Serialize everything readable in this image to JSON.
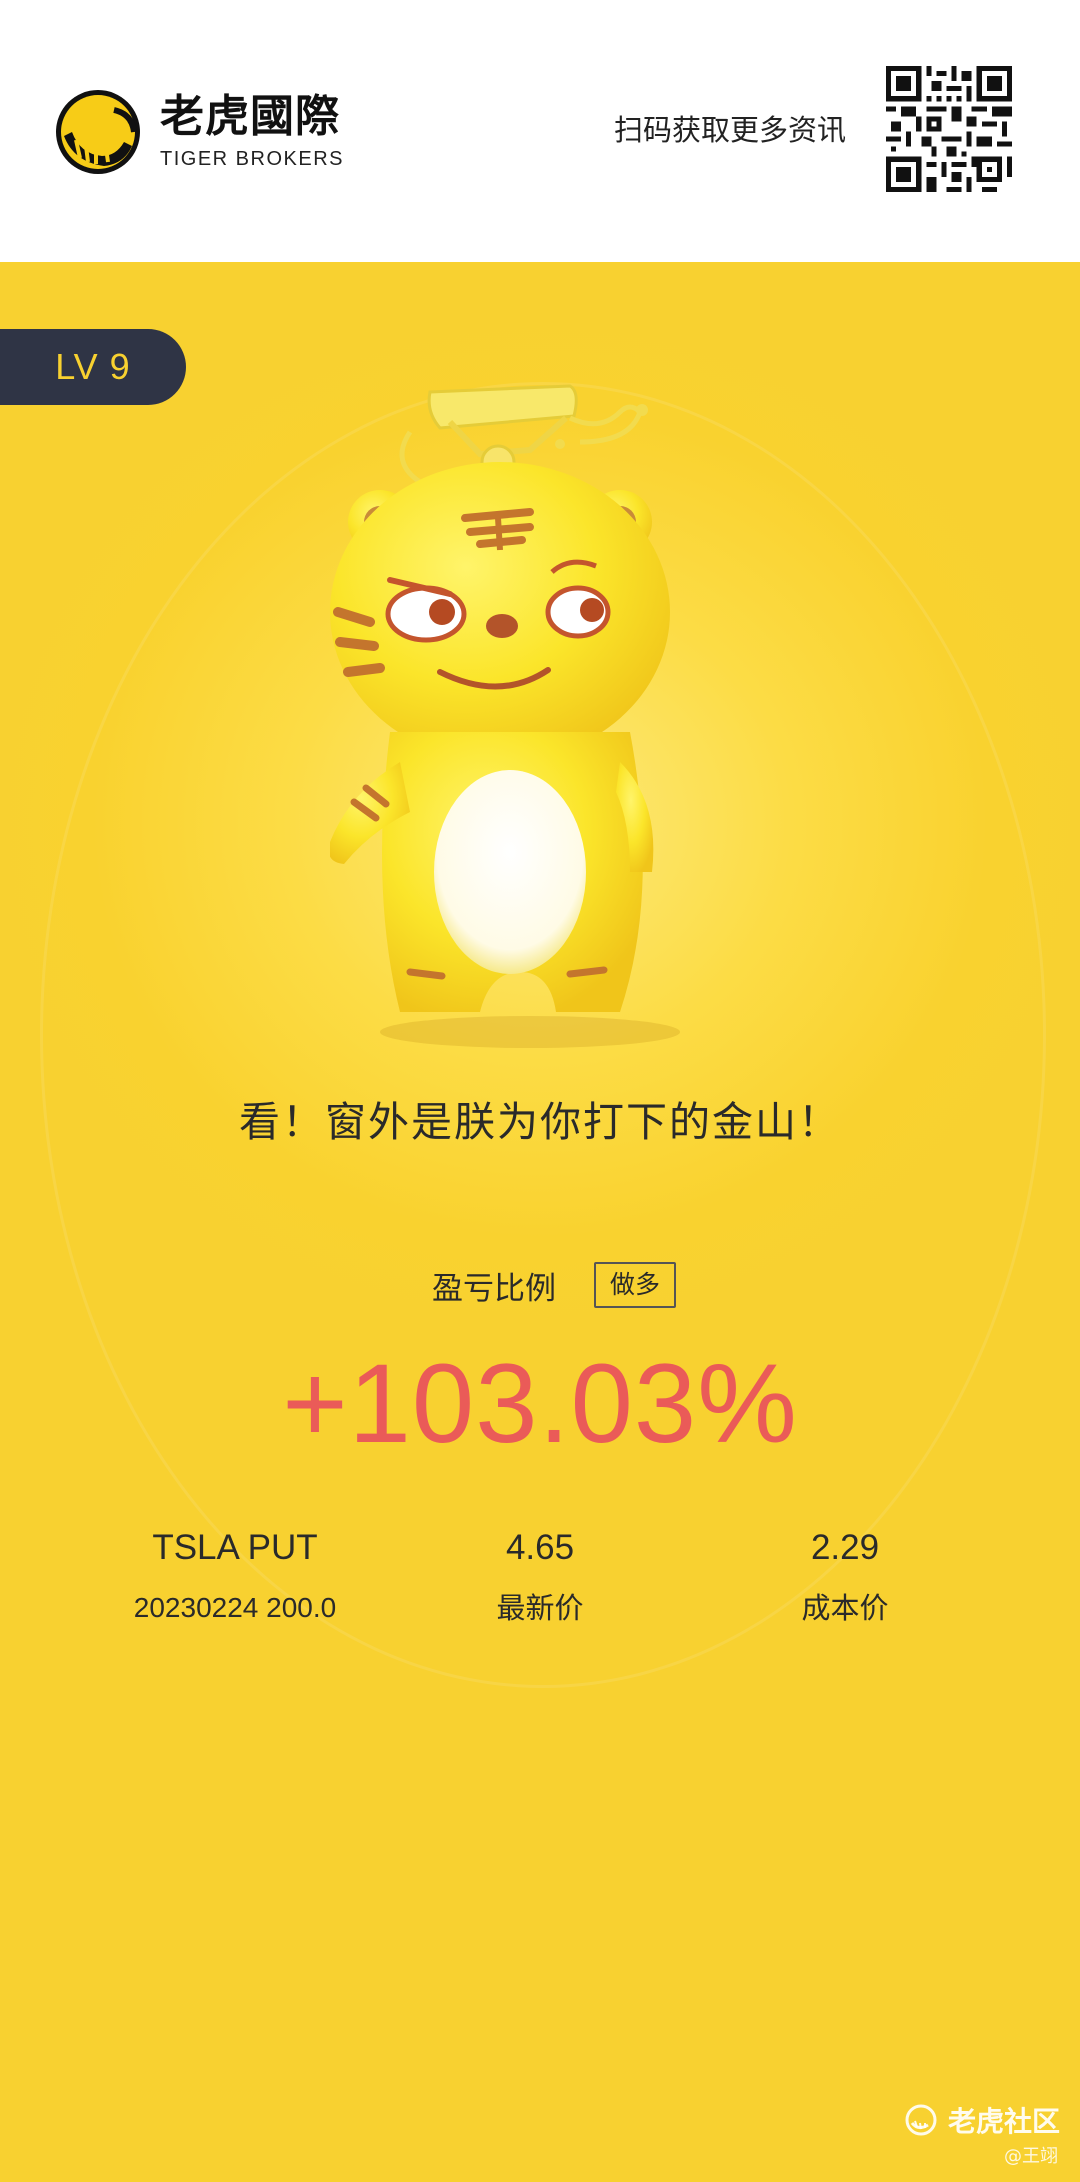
{
  "header": {
    "logo_cn": "老虎國際",
    "logo_en": "TIGER BROKERS",
    "scan_text": "扫码获取更多资讯"
  },
  "badge": {
    "level": "LV 9"
  },
  "slogan": "看！窗外是朕为你打下的金山！",
  "pnl": {
    "label": "盈亏比例",
    "direction_tag": "做多",
    "value": "+103.03%"
  },
  "stats": {
    "instrument": "TSLA PUT",
    "contract": "20230224 200.0",
    "latest_price": "4.65",
    "latest_price_label": "最新价",
    "cost_price": "2.29",
    "cost_price_label": "成本价"
  },
  "watermark": {
    "brand": "老虎社区",
    "user": "@王翊"
  },
  "colors": {
    "card_yellow": "#f9d22f",
    "badge_dark": "#2f3445",
    "profit_red": "#ea5b58"
  },
  "icons": [
    "tiger-brokers-logo-icon",
    "qr-code-icon",
    "tiger-mascot-image",
    "tiger-community-icon"
  ]
}
